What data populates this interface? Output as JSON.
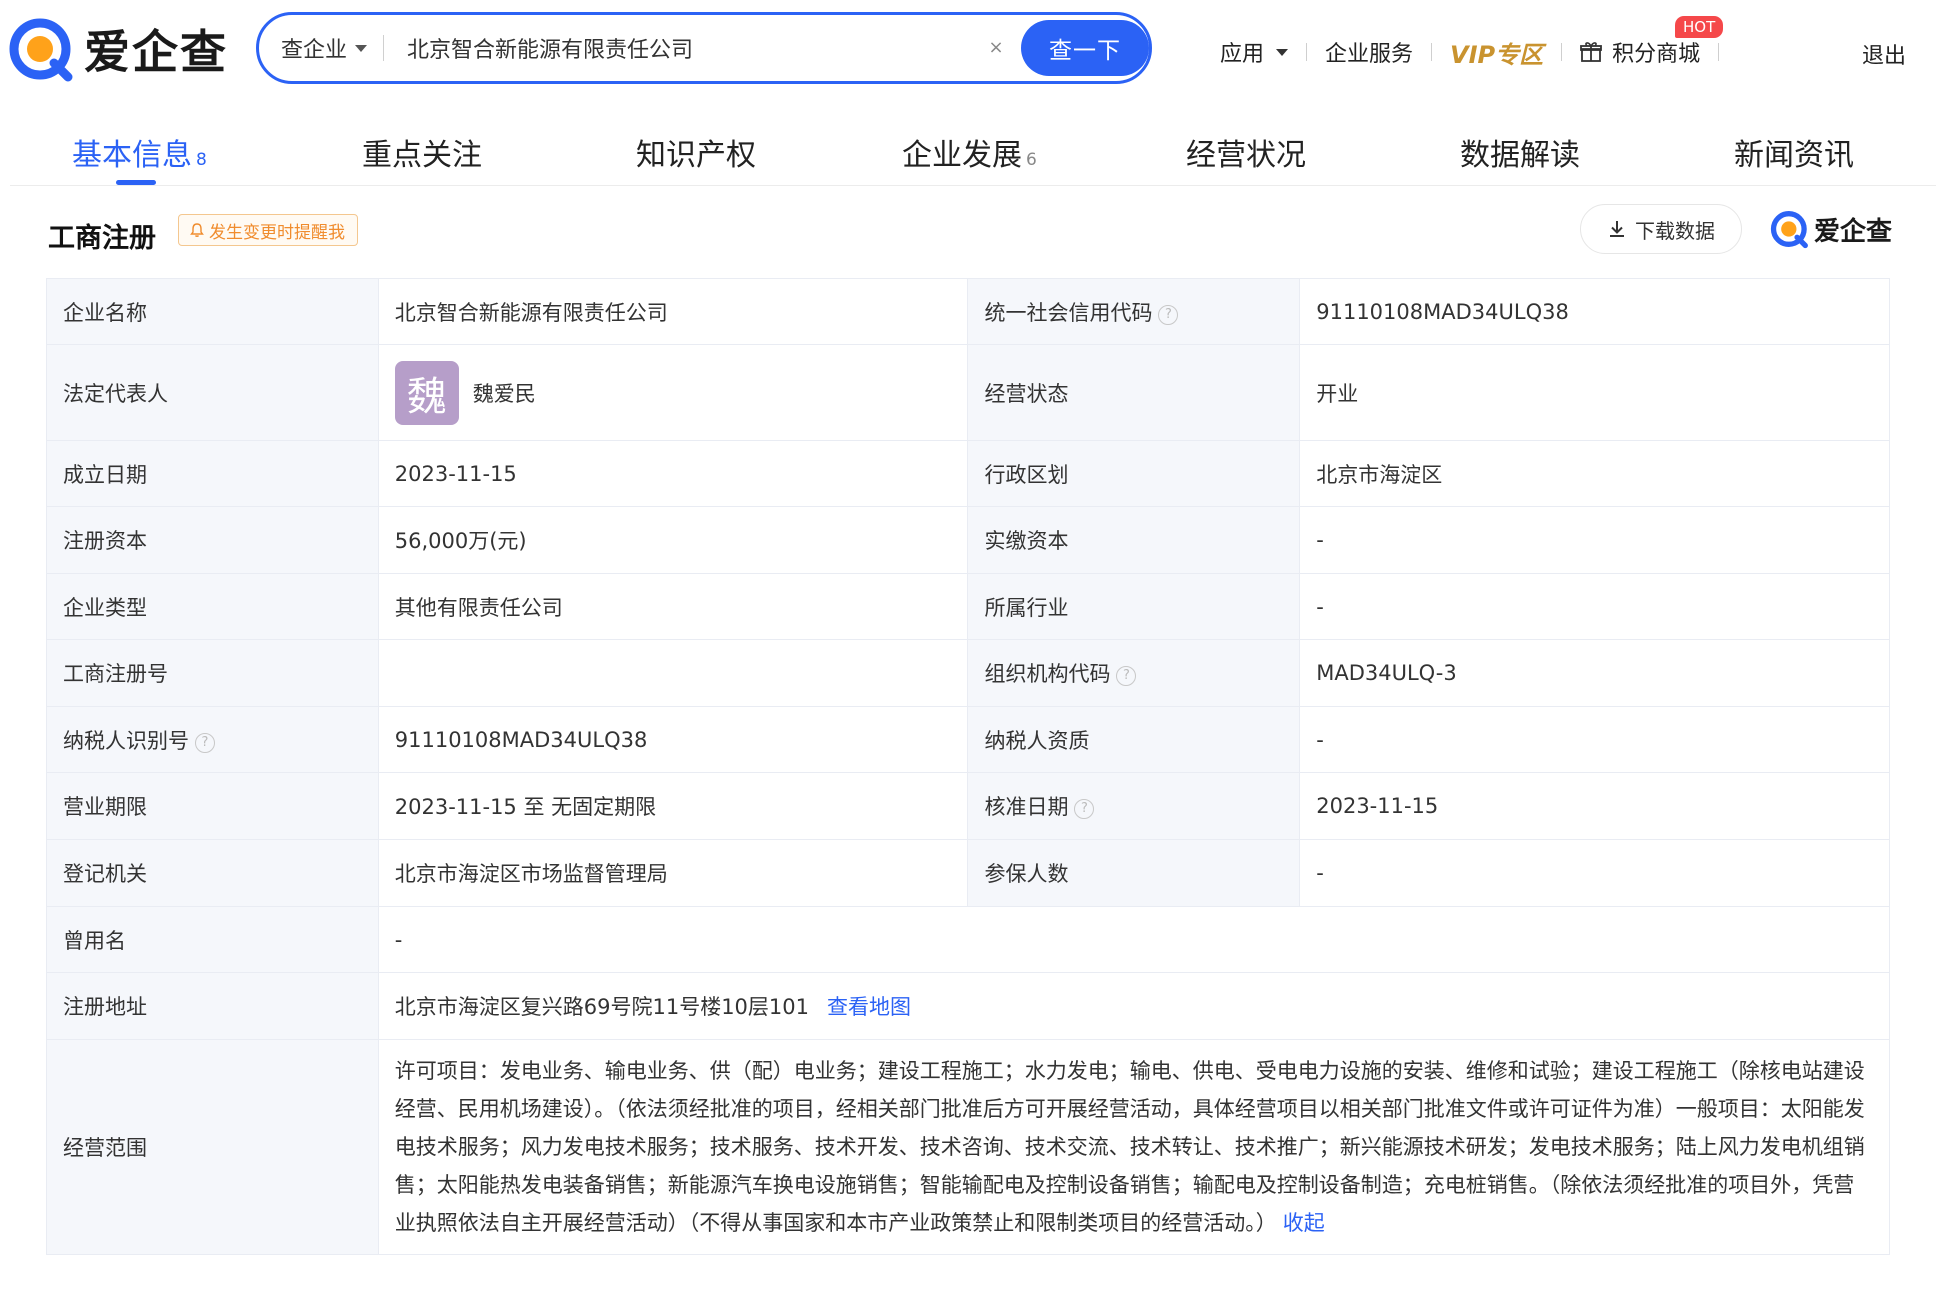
{
  "brand": {
    "name": "爱企查"
  },
  "search": {
    "scope": "查企业",
    "value": "北京智合新能源有限责任公司",
    "clear": "×",
    "button": "查一下"
  },
  "topnav": {
    "apps": "应用",
    "enterprise_service": "企业服务",
    "vip": "VIP专区",
    "points_mall": "积分商城",
    "hot_badge": "HOT",
    "logout": "退出"
  },
  "tabs": [
    {
      "label": "基本信息",
      "count": "8"
    },
    {
      "label": "重点关注",
      "count": ""
    },
    {
      "label": "知识产权",
      "count": ""
    },
    {
      "label": "企业发展",
      "count": "6"
    },
    {
      "label": "经营状况",
      "count": ""
    },
    {
      "label": "数据解读",
      "count": ""
    },
    {
      "label": "新闻资讯",
      "count": ""
    }
  ],
  "section": {
    "title": "工商注册",
    "remind": "发生变更时提醒我",
    "download": "下载数据",
    "brand": "爱企查"
  },
  "info": {
    "company_name_label": "企业名称",
    "company_name": "北京智合新能源有限责任公司",
    "credit_code_label": "统一社会信用代码",
    "credit_code": "91110108MAD34ULQ38",
    "legal_rep_label": "法定代表人",
    "legal_rep_avatar": "魏",
    "legal_rep": "魏爱民",
    "status_label": "经营状态",
    "status": "开业",
    "founded_label": "成立日期",
    "founded": "2023-11-15",
    "district_label": "行政区划",
    "district": "北京市海淀区",
    "reg_capital_label": "注册资本",
    "reg_capital": "56,000万(元)",
    "paid_capital_label": "实缴资本",
    "paid_capital": "-",
    "type_label": "企业类型",
    "type": "其他有限责任公司",
    "industry_label": "所属行业",
    "industry": "-",
    "reg_no_label": "工商注册号",
    "reg_no": "",
    "org_code_label": "组织机构代码",
    "org_code": "MAD34ULQ-3",
    "taxpayer_id_label": "纳税人识别号",
    "taxpayer_id": "91110108MAD34ULQ38",
    "taxpayer_qual_label": "纳税人资质",
    "taxpayer_qual": "-",
    "term_label": "营业期限",
    "term": "2023-11-15 至 无固定期限",
    "approval_date_label": "核准日期",
    "approval_date": "2023-11-15",
    "authority_label": "登记机关",
    "authority": "北京市海淀区市场监督管理局",
    "insured_label": "参保人数",
    "insured": "-",
    "former_name_label": "曾用名",
    "former_name": "-",
    "address_label": "注册地址",
    "address": "北京市海淀区复兴路69号院11号楼10层101",
    "map_link": "查看地图",
    "scope_label": "经营范围",
    "scope": "许可项目：发电业务、输电业务、供（配）电业务；建设工程施工；水力发电；输电、供电、受电电力设施的安装、维修和试验；建设工程施工（除核电站建设经营、民用机场建设）。（依法须经批准的项目，经相关部门批准后方可开展经营活动，具体经营项目以相关部门批准文件或许可证件为准）一般项目：太阳能发电技术服务；风力发电技术服务；技术服务、技术开发、技术咨询、技术交流、技术转让、技术推广；新兴能源技术研发；发电技术服务；陆上风力发电机组销售；太阳能热发电装备销售；新能源汽车换电设施销售；智能输配电及控制设备销售；输配电及控制设备制造；充电桩销售。（除依法须经批准的项目外，凭营业执照依法自主开展经营活动）（不得从事国家和本市产业政策禁止和限制类项目的经营活动。）",
    "collapse": "收起"
  },
  "colors": {
    "accent": "#2b62f5",
    "remind": "#f08c2e",
    "vip": "#c9932f",
    "hot": "#f5484a",
    "label_bg": "#f5f7fb"
  }
}
